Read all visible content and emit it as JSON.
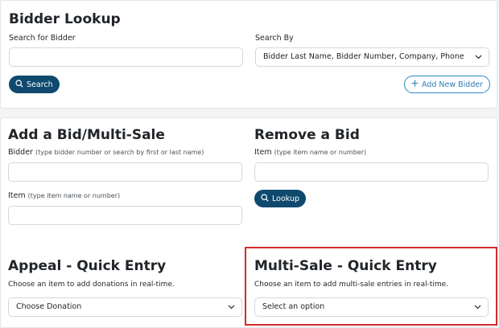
{
  "bidder_lookup": {
    "title": "Bidder Lookup",
    "search_label": "Search for Bidder",
    "search_value": "",
    "search_by_label": "Search By",
    "search_by_value": "Bidder Last Name, Bidder Number, Company, Phone",
    "search_button": "Search",
    "add_bidder_button": "Add New Bidder",
    "icons": {
      "search": "search-icon",
      "add": "plus-icon",
      "dropdown": "chevron-down-icon"
    }
  },
  "add_bid": {
    "title": "Add a Bid/Multi-Sale",
    "bidder_label": "Bidder",
    "bidder_hint": "(type bidder number or search by first or last name)",
    "bidder_value": "",
    "item_label": "Item",
    "item_hint": "(type item name or number)",
    "item_value": ""
  },
  "remove_bid": {
    "title": "Remove a Bid",
    "item_label": "Item",
    "item_hint": "(type item name or number)",
    "item_value": "",
    "lookup_button": "Lookup"
  },
  "appeal_quick": {
    "title": "Appeal - Quick Entry",
    "description": "Choose an item to add donations in real-time.",
    "select_value": "Choose Donation"
  },
  "multisale_quick": {
    "title": "Multi-Sale - Quick Entry",
    "description": "Choose an item to add multi-sale entries in real-time.",
    "select_value": "Select an option"
  },
  "colors": {
    "primary_button": "#0f4a6e",
    "outline_button": "#2b8ac2",
    "highlight": "#d42a2a",
    "page_background": "#f3f4f6"
  }
}
